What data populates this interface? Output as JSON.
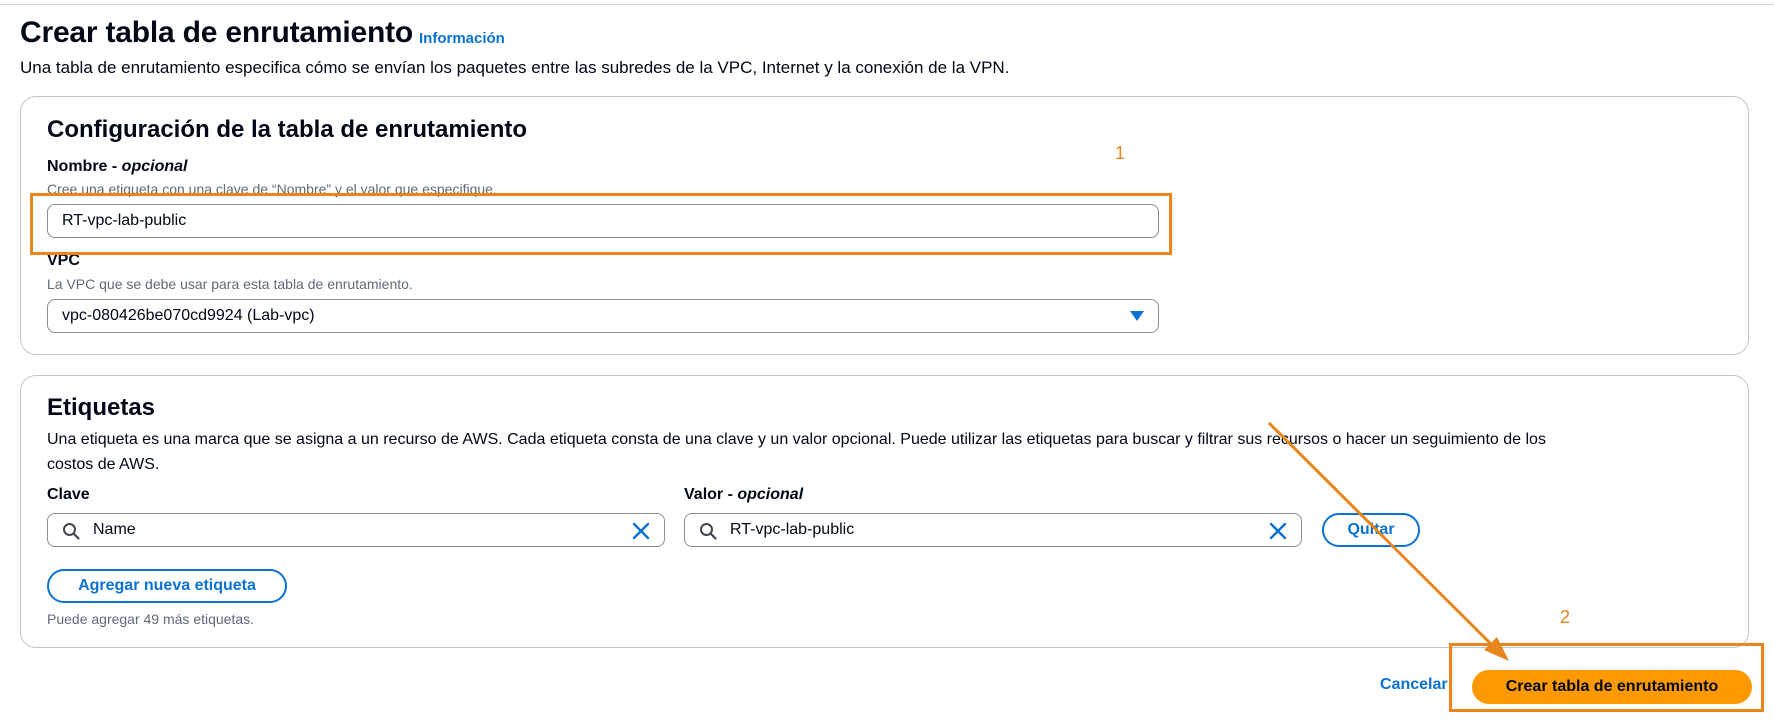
{
  "page": {
    "title": "Crear tabla de enrutamiento",
    "info_link": "Información",
    "description": "Una tabla de enrutamiento especifica cómo se envían los paquetes entre las subredes de la VPC, Internet y la conexión de la VPN."
  },
  "config_panel": {
    "title": "Configuración de la tabla de enrutamiento",
    "name_label": "Nombre - ",
    "name_optional": "opcional",
    "name_hint": "Cree una etiqueta con una clave de “Nombre” y el valor que especifique.",
    "name_value": "RT-vpc-lab-public",
    "vpc_label": "VPC",
    "vpc_hint": "La VPC que se debe usar para esta tabla de enrutamiento.",
    "vpc_value": "vpc-080426be070cd9924 (Lab-vpc)"
  },
  "tags_panel": {
    "title": "Etiquetas",
    "description_line1": "Una etiqueta es una marca que se asigna a un recurso de AWS. Cada etiqueta consta de una clave y un valor opcional. Puede utilizar las etiquetas para buscar y filtrar sus recursos o hacer un seguimiento de los",
    "description_line2": "costos de AWS.",
    "key_label": "Clave",
    "value_label": "Valor - ",
    "value_optional": "opcional",
    "key_value": "Name",
    "value_value": "RT-vpc-lab-public",
    "remove_button": "Quitar",
    "add_button": "Agregar nueva etiqueta",
    "remaining_hint": "Puede agregar 49 más etiquetas."
  },
  "footer": {
    "cancel_button": "Cancelar",
    "create_button": "Crear tabla de enrutamiento"
  },
  "annotations": {
    "step1": "1",
    "step2": "2"
  },
  "colors": {
    "accent": "#0972d3",
    "primary_button": "#ff9900",
    "annotation": "#e8851c"
  }
}
